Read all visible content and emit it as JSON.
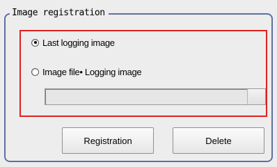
{
  "group": {
    "title": "Image registration"
  },
  "options": {
    "last_logging": "Last logging image",
    "image_file": "Image file• Logging image",
    "selected": "last_logging"
  },
  "buttons": {
    "registration": "Registration",
    "delete": "Delete"
  }
}
